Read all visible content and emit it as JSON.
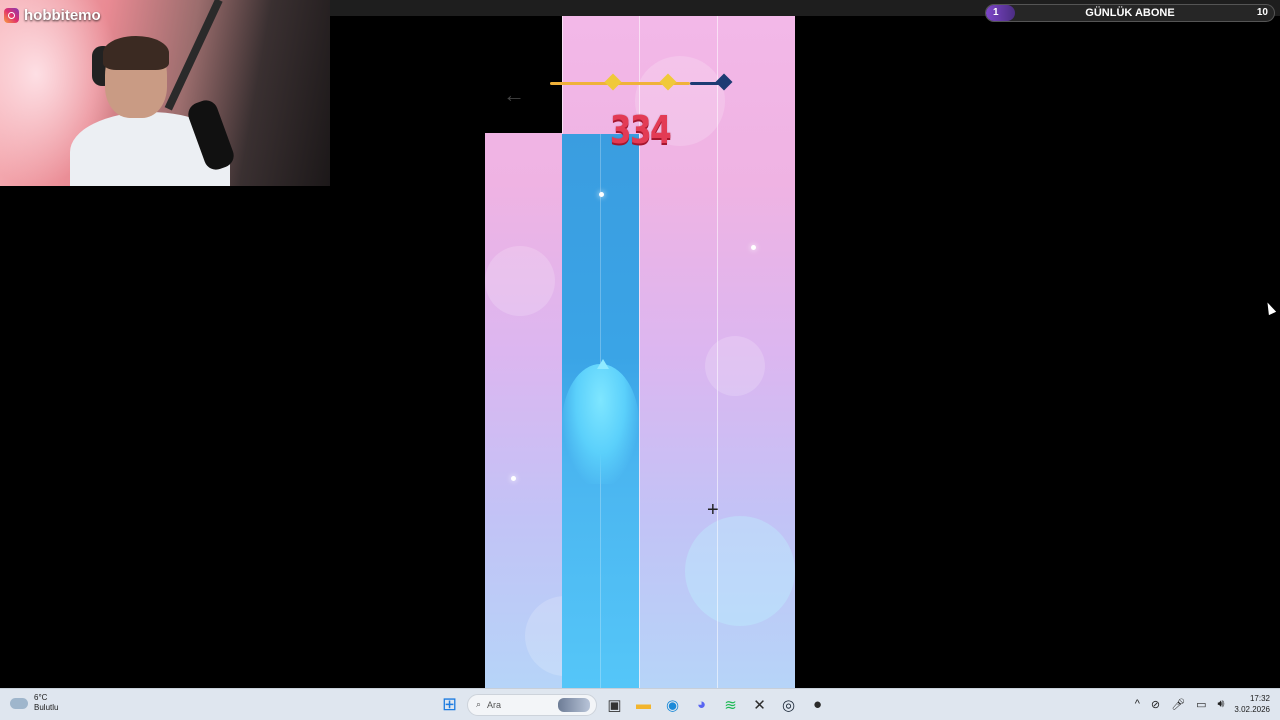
{
  "stream": {
    "channel_name": "hobbitemo",
    "sub_goal": {
      "current": "1",
      "label": "GÜNLÜK ABONE",
      "target": "10",
      "progress": 0.1
    }
  },
  "game": {
    "back_icon": "←",
    "score": "334",
    "level_progress": 0.78,
    "stars": [
      {
        "name": "star-1",
        "color": "#f0c93a"
      },
      {
        "name": "star-2",
        "color": "#f0c93a"
      },
      {
        "name": "star-3",
        "color": "#1d3b73"
      }
    ],
    "crosshair": "+"
  },
  "taskbar": {
    "weather": {
      "temp": "6°C",
      "condition": "Bulutlu"
    },
    "search_placeholder": "Ara",
    "apps": [
      {
        "name": "start-icon",
        "glyph": "⊞",
        "color": "#1f7de0"
      },
      {
        "name": "task-view-icon",
        "glyph": "▣",
        "color": "#333333"
      },
      {
        "name": "file-explorer-icon",
        "glyph": "▬",
        "color": "#f2b52e"
      },
      {
        "name": "edge-icon",
        "glyph": "◉",
        "color": "#1b8ad8"
      },
      {
        "name": "discord-icon",
        "glyph": "◕",
        "color": "#5865f2"
      },
      {
        "name": "spotify-icon",
        "glyph": "≋",
        "color": "#1db954"
      },
      {
        "name": "xbox-icon",
        "glyph": "✕",
        "color": "#2d2d2d"
      },
      {
        "name": "steam-icon",
        "glyph": "◎",
        "color": "#1b2838"
      },
      {
        "name": "obs-icon",
        "glyph": "●",
        "color": "#2a2a2a"
      }
    ],
    "tray_glyphs": [
      "^",
      "⊘",
      "🎤︎",
      "▭",
      "🔊︎"
    ],
    "time": "17:32",
    "date": "3.02.2026"
  }
}
